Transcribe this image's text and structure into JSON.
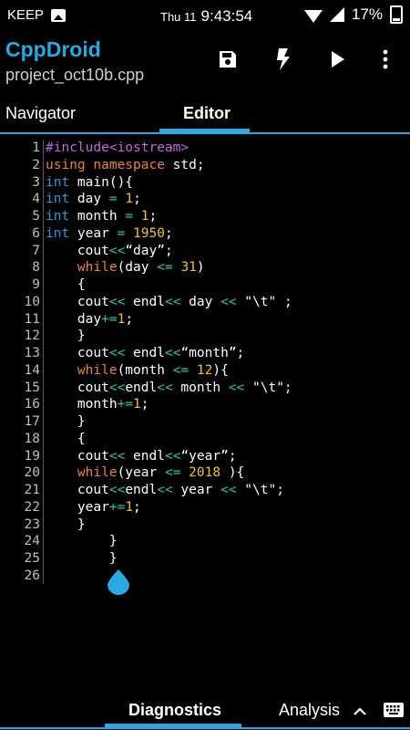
{
  "status_bar": {
    "app_name": "KEEP",
    "date": "Thu 11",
    "time": "9:43:54",
    "battery": "17%"
  },
  "app_bar": {
    "title": "CppDroid",
    "subtitle": "project_oct10b.cpp",
    "actions": [
      "save-icon",
      "flash-icon",
      "play-icon",
      "more-vert-icon"
    ]
  },
  "tabs": [
    {
      "label": "Navigator",
      "active": false
    },
    {
      "label": "Editor",
      "active": true
    }
  ],
  "editor": {
    "lines": [
      {
        "n": "1",
        "tokens": [
          {
            "t": "#include<iostream>",
            "c": "pp"
          }
        ]
      },
      {
        "n": "2",
        "tokens": [
          {
            "t": "using namespace",
            "c": "kw"
          },
          {
            "t": " std;",
            "c": "tx"
          }
        ]
      },
      {
        "n": "3",
        "tokens": [
          {
            "t": "int",
            "c": "ty"
          },
          {
            "t": " main(){",
            "c": "tx"
          }
        ]
      },
      {
        "n": "4",
        "tokens": [
          {
            "t": "int",
            "c": "ty"
          },
          {
            "t": " day ",
            "c": "tx"
          },
          {
            "t": "=",
            "c": "op"
          },
          {
            "t": " ",
            "c": "tx"
          },
          {
            "t": "1",
            "c": "nm"
          },
          {
            "t": ";",
            "c": "tx"
          }
        ]
      },
      {
        "n": "5",
        "tokens": [
          {
            "t": "int",
            "c": "ty"
          },
          {
            "t": " month ",
            "c": "tx"
          },
          {
            "t": "=",
            "c": "op"
          },
          {
            "t": " ",
            "c": "tx"
          },
          {
            "t": "1",
            "c": "nm"
          },
          {
            "t": ";",
            "c": "tx"
          }
        ]
      },
      {
        "n": "6",
        "tokens": [
          {
            "t": "int",
            "c": "ty"
          },
          {
            "t": " year ",
            "c": "tx"
          },
          {
            "t": "=",
            "c": "op"
          },
          {
            "t": " ",
            "c": "tx"
          },
          {
            "t": "1950",
            "c": "nm"
          },
          {
            "t": ";",
            "c": "tx"
          }
        ]
      },
      {
        "n": "7",
        "tokens": [
          {
            "t": "    cout",
            "c": "tx"
          },
          {
            "t": "<<",
            "c": "op"
          },
          {
            "t": "“day”;",
            "c": "tx"
          }
        ]
      },
      {
        "n": "8",
        "tokens": [
          {
            "t": "    ",
            "c": "tx"
          },
          {
            "t": "while",
            "c": "kw"
          },
          {
            "t": "(day ",
            "c": "tx"
          },
          {
            "t": "<=",
            "c": "op"
          },
          {
            "t": " ",
            "c": "tx"
          },
          {
            "t": "31",
            "c": "nm"
          },
          {
            "t": ")",
            "c": "tx"
          }
        ]
      },
      {
        "n": "9",
        "tokens": [
          {
            "t": "    {",
            "c": "tx"
          }
        ]
      },
      {
        "n": "10",
        "tokens": [
          {
            "t": "    cout",
            "c": "tx"
          },
          {
            "t": "<<",
            "c": "op"
          },
          {
            "t": " endl",
            "c": "tx"
          },
          {
            "t": "<<",
            "c": "op"
          },
          {
            "t": " day ",
            "c": "tx"
          },
          {
            "t": "<<",
            "c": "op"
          },
          {
            "t": " \"\\t\" ;",
            "c": "tx"
          }
        ]
      },
      {
        "n": "11",
        "tokens": [
          {
            "t": "    day",
            "c": "tx"
          },
          {
            "t": "+=",
            "c": "op"
          },
          {
            "t": "1",
            "c": "nm"
          },
          {
            "t": ";",
            "c": "tx"
          }
        ]
      },
      {
        "n": "12",
        "tokens": [
          {
            "t": "    }",
            "c": "tx"
          }
        ]
      },
      {
        "n": "13",
        "tokens": [
          {
            "t": "    cout",
            "c": "tx"
          },
          {
            "t": "<<",
            "c": "op"
          },
          {
            "t": " endl",
            "c": "tx"
          },
          {
            "t": "<<",
            "c": "op"
          },
          {
            "t": "“month”;",
            "c": "tx"
          }
        ]
      },
      {
        "n": "14",
        "tokens": [
          {
            "t": "    ",
            "c": "tx"
          },
          {
            "t": "while",
            "c": "kw"
          },
          {
            "t": "(month ",
            "c": "tx"
          },
          {
            "t": "<=",
            "c": "op"
          },
          {
            "t": " ",
            "c": "tx"
          },
          {
            "t": "12",
            "c": "nm"
          },
          {
            "t": "){",
            "c": "tx"
          }
        ]
      },
      {
        "n": "15",
        "tokens": [
          {
            "t": "    cout",
            "c": "tx"
          },
          {
            "t": "<<",
            "c": "op"
          },
          {
            "t": "endl",
            "c": "tx"
          },
          {
            "t": "<<",
            "c": "op"
          },
          {
            "t": " month ",
            "c": "tx"
          },
          {
            "t": "<<",
            "c": "op"
          },
          {
            "t": " \"\\t\";",
            "c": "tx"
          }
        ]
      },
      {
        "n": "16",
        "tokens": [
          {
            "t": "    month",
            "c": "tx"
          },
          {
            "t": "+=",
            "c": "op"
          },
          {
            "t": "1",
            "c": "nm"
          },
          {
            "t": ";",
            "c": "tx"
          }
        ]
      },
      {
        "n": "17",
        "tokens": [
          {
            "t": "    }",
            "c": "tx"
          }
        ]
      },
      {
        "n": "18",
        "tokens": [
          {
            "t": "    {",
            "c": "tx"
          }
        ]
      },
      {
        "n": "19",
        "tokens": [
          {
            "t": "    cout",
            "c": "tx"
          },
          {
            "t": "<<",
            "c": "op"
          },
          {
            "t": " endl",
            "c": "tx"
          },
          {
            "t": "<<",
            "c": "op"
          },
          {
            "t": "“year”;",
            "c": "tx"
          }
        ]
      },
      {
        "n": "20",
        "tokens": [
          {
            "t": "    ",
            "c": "tx"
          },
          {
            "t": "while",
            "c": "kw"
          },
          {
            "t": "(year ",
            "c": "tx"
          },
          {
            "t": "<=",
            "c": "op"
          },
          {
            "t": " ",
            "c": "tx"
          },
          {
            "t": "2018",
            "c": "nm"
          },
          {
            "t": " ){",
            "c": "tx"
          }
        ]
      },
      {
        "n": "21",
        "tokens": [
          {
            "t": "    cout",
            "c": "tx"
          },
          {
            "t": "<<",
            "c": "op"
          },
          {
            "t": "endl",
            "c": "tx"
          },
          {
            "t": "<<",
            "c": "op"
          },
          {
            "t": " year ",
            "c": "tx"
          },
          {
            "t": "<<",
            "c": "op"
          },
          {
            "t": " \"\\t\";",
            "c": "tx"
          }
        ]
      },
      {
        "n": "22",
        "tokens": [
          {
            "t": "    year",
            "c": "tx"
          },
          {
            "t": "+=",
            "c": "op"
          },
          {
            "t": "1",
            "c": "nm"
          },
          {
            "t": ";",
            "c": "tx"
          }
        ]
      },
      {
        "n": "23",
        "tokens": [
          {
            "t": "    }",
            "c": "tx"
          }
        ]
      },
      {
        "n": "24",
        "tokens": [
          {
            "t": "        }",
            "c": "tx"
          }
        ]
      },
      {
        "n": "25",
        "tokens": [
          {
            "t": "        }",
            "c": "tx"
          }
        ]
      },
      {
        "n": "26",
        "tokens": []
      }
    ]
  },
  "bottom_tabs": [
    {
      "label": "Diagnostics",
      "active": true
    },
    {
      "label": "Analysis",
      "active": false
    }
  ],
  "colors": {
    "accent": "#2ba8e0",
    "keyword": "#e2873a",
    "type": "#2a9bd6",
    "preprocessor": "#c06ad6",
    "number": "#f0c03a",
    "operator": "#2ec4a8"
  }
}
